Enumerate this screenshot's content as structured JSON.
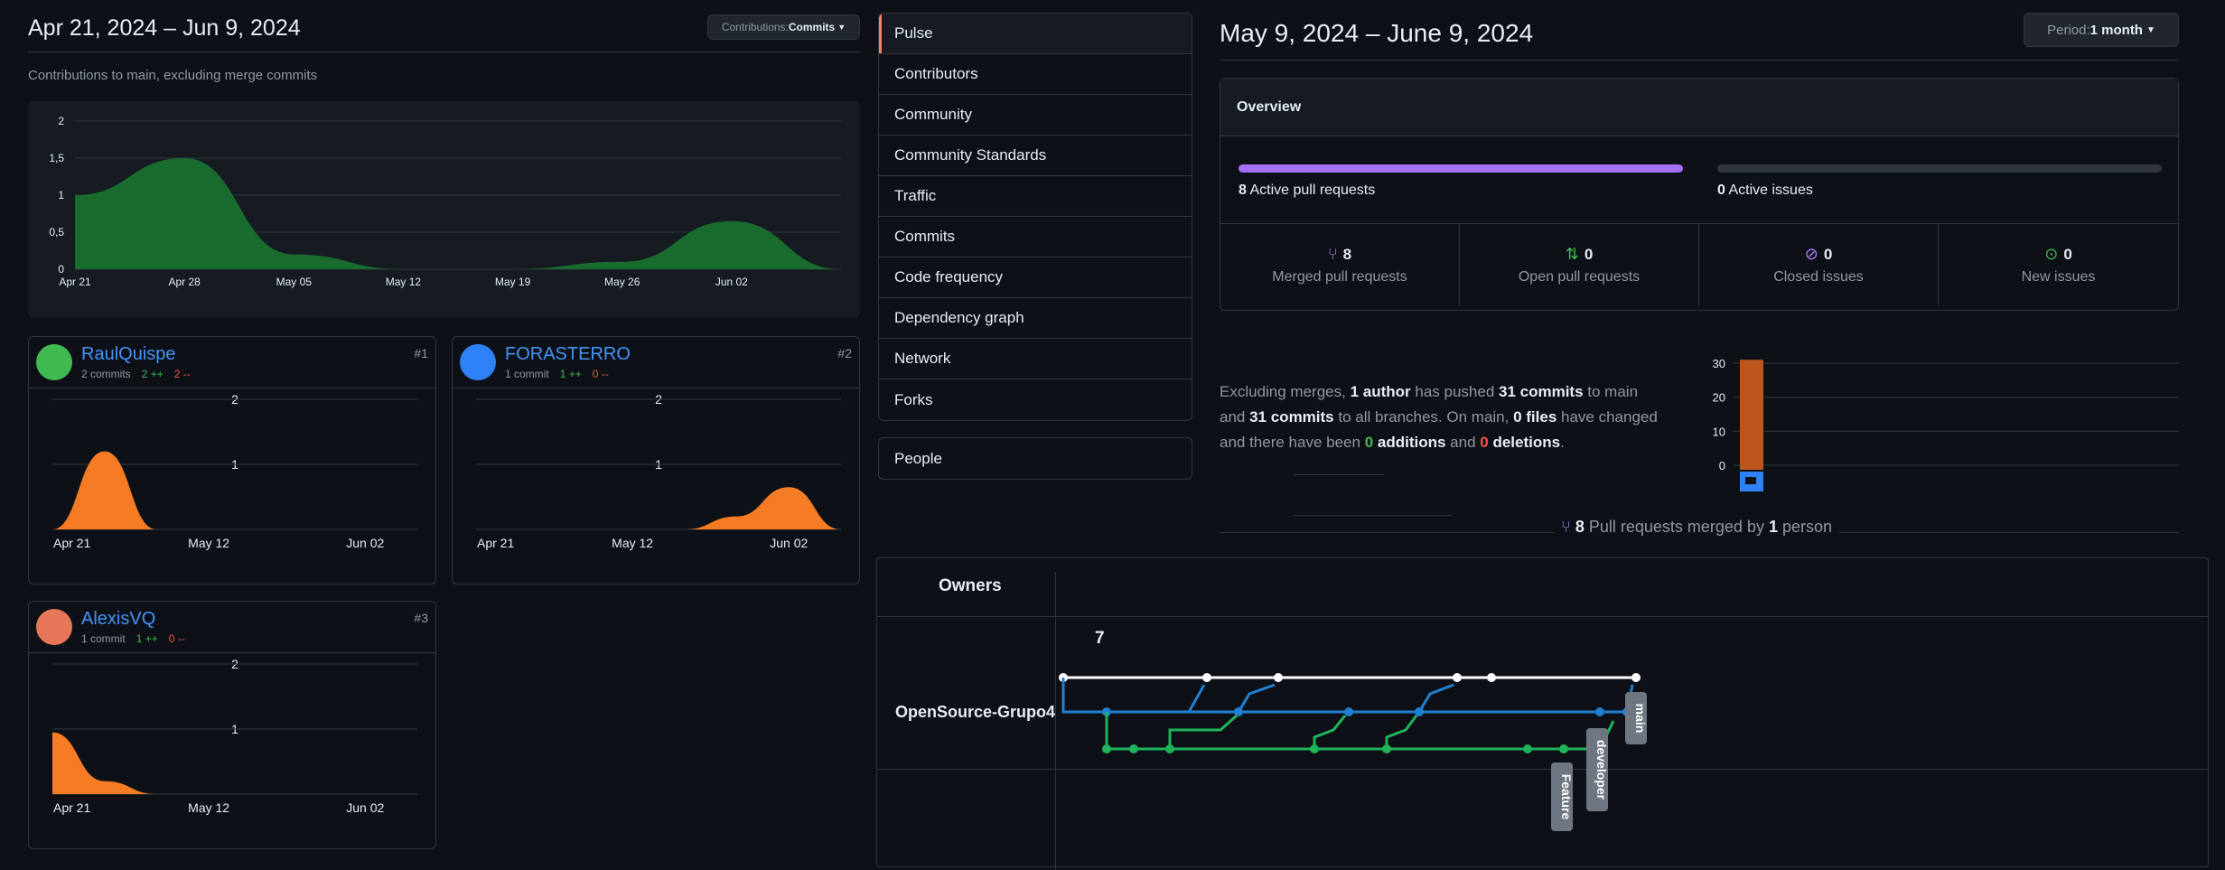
{
  "contributors_panel": {
    "range": "Apr 21, 2024 – Jun 9, 2024",
    "contributions_button_prefix": "Contributions: ",
    "contributions_button_value": "Commits",
    "subtitle": "Contributions to main, excluding merge commits",
    "chart_ticks_x": [
      "Apr 21",
      "Apr 28",
      "May 05",
      "May 12",
      "May 19",
      "May 26",
      "Jun 02"
    ],
    "chart_ticks_y": [
      "2",
      "1,5",
      "1",
      "0,5",
      "0"
    ],
    "contributors": [
      {
        "name": "RaulQuispe",
        "commits": "2 commits",
        "additions": "2 ++",
        "deletions": "2 --",
        "rank": "#1",
        "avatar_color": "#3fb950"
      },
      {
        "name": "FORASTERRO",
        "commits": "1 commit",
        "additions": "1 ++",
        "deletions": "0 --",
        "rank": "#2",
        "avatar_color": "#2f81f7"
      },
      {
        "name": "AlexisVQ",
        "commits": "1 commit",
        "additions": "1 ++",
        "deletions": "0 --",
        "rank": "#3",
        "avatar_color": "#e8775a"
      }
    ],
    "small_ticks_x": [
      "Apr 21",
      "May 12",
      "Jun 02"
    ],
    "small_ticks_y": [
      "2",
      "1"
    ]
  },
  "chart_data": [
    {
      "type": "area",
      "title": "",
      "x": [
        "Apr 21",
        "Apr 28",
        "May 05",
        "May 12",
        "May 19",
        "May 26",
        "Jun 02",
        "Jun 09"
      ],
      "values": [
        1,
        1.5,
        0.2,
        0,
        0,
        0.1,
        0.65,
        0
      ],
      "ylim": [
        0,
        2
      ],
      "color": "#196c2e"
    },
    {
      "type": "area",
      "series": [
        {
          "name": "RaulQuispe",
          "values": [
            0,
            1.2,
            0,
            0,
            0,
            0,
            0,
            0
          ]
        }
      ],
      "ylim": [
        0,
        2
      ],
      "color": "#f57c25"
    },
    {
      "type": "area",
      "series": [
        {
          "name": "FORASTERRO",
          "values": [
            0,
            0,
            0,
            0,
            0,
            0.2,
            0.65,
            0
          ]
        }
      ],
      "ylim": [
        0,
        2
      ],
      "color": "#f57c25"
    },
    {
      "type": "area",
      "series": [
        {
          "name": "AlexisVQ",
          "values": [
            0.95,
            0.2,
            0,
            0,
            0,
            0,
            0,
            0
          ]
        }
      ],
      "ylim": [
        0,
        2
      ],
      "color": "#f57c25"
    },
    {
      "type": "bar",
      "categories": [
        "author"
      ],
      "values": [
        31
      ],
      "yticks": [
        "30",
        "20",
        "10",
        "0"
      ],
      "ylim": [
        0,
        32
      ],
      "color": "#bd561d"
    }
  ],
  "nav": {
    "items": [
      "Pulse",
      "Contributors",
      "Community",
      "Community Standards",
      "Traffic",
      "Commits",
      "Code frequency",
      "Dependency graph",
      "Network",
      "Forks"
    ],
    "people": "People"
  },
  "pulse": {
    "range": "May 9, 2024 – June 9, 2024",
    "period_prefix": "Period: ",
    "period_value": "1 month",
    "overview_title": "Overview",
    "active_prs_n": "8",
    "active_prs_label": " Active pull requests",
    "active_issues_n": "0",
    "active_issues_label": " Active issues",
    "stats": [
      {
        "n": "8",
        "label": "Merged pull requests",
        "color": "#ab7df8",
        "icon": "merge-icon"
      },
      {
        "n": "0",
        "label": "Open pull requests",
        "color": "#3fb950",
        "icon": "pull-request-icon"
      },
      {
        "n": "0",
        "label": "Closed issues",
        "color": "#ab7df8",
        "icon": "issue-closed-icon"
      },
      {
        "n": "0",
        "label": "New issues",
        "color": "#3fb950",
        "icon": "issue-opened-icon"
      }
    ],
    "summary": {
      "t1": "Excluding merges, ",
      "b1": "1 author",
      "t2": " has pushed ",
      "b2": "31 commits",
      "t3": " to main",
      "t4": "and ",
      "b4": "31 commits",
      "t5": " to all branches. On main, ",
      "b5": "0 files",
      "t6": " have changed",
      "t7": "and there have been ",
      "g": "0",
      "b7": " additions",
      "t8": " and ",
      "r": "0",
      "b8": " deletions",
      "t9": "."
    },
    "merged_line": {
      "n": "8",
      "t1": " Pull requests merged by ",
      "b": "1",
      "t2": " person"
    }
  },
  "network": {
    "owners_label": "Owners",
    "month_label": "7",
    "owner": "OpenSource-Grupo4",
    "branches": [
      "main",
      "developer",
      "Feature"
    ],
    "colors": {
      "main": "#ffffff",
      "developer": "#1f7fd1",
      "feature": "#1fb35a"
    }
  }
}
